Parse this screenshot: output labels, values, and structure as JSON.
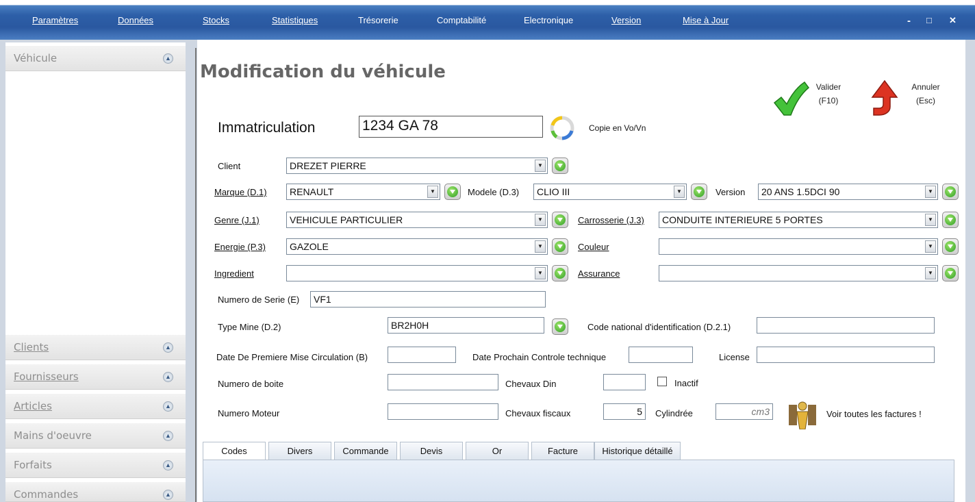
{
  "menu": {
    "items": [
      "Paramètres",
      "Données",
      "Stocks",
      "Statistiques",
      "Trésorerie",
      "Comptabilité",
      "Electronique",
      "Version",
      "Mise à Jour"
    ],
    "minimize": "-",
    "maximize": "□",
    "close": "✕"
  },
  "sidebar": {
    "top": "Véhicule",
    "items": [
      "Clients",
      "Fournisseurs",
      "Articles",
      "Mains d'oeuvre",
      "Forfaits",
      "Commandes"
    ]
  },
  "title": "Modification du véhicule",
  "actions": {
    "valider": "Valider",
    "valider_key": "(F10)",
    "annuler": "Annuler",
    "annuler_key": "(Esc)"
  },
  "immat": {
    "label": "Immatriculation",
    "value": "1234 GA 78",
    "copy_label": "Copie en Vo/Vn"
  },
  "fields": {
    "client_label": "Client",
    "client_value": "DREZET PIERRE",
    "marque_label": "Marque (D.1)",
    "marque_value": "RENAULT",
    "modele_label": "Modele (D.3)",
    "modele_value": "CLIO III",
    "version_label": "Version",
    "version_value": "20 ANS 1.5DCI 90",
    "genre_label": "Genre (J.1)",
    "genre_value": "VEHICULE PARTICULIER",
    "carrosserie_label": "Carrosserie (J.3)",
    "carrosserie_value": "CONDUITE INTERIEURE 5 PORTES",
    "energie_label": "Energie (P.3)",
    "energie_value": "GAZOLE",
    "couleur_label": "Couleur",
    "couleur_value": "",
    "ingredient_label": "Ingredient",
    "ingredient_value": "",
    "assurance_label": "Assurance",
    "assurance_value": "",
    "serie_label": "Numero de Serie (E)",
    "serie_value": "VF1",
    "typemine_label": "Type Mine (D.2)",
    "typemine_value": "BR2H0H",
    "codenat_label": "Code national d'identification (D.2.1)",
    "codenat_value": "",
    "date_mec_label": "Date De Premiere Mise Circulation (B)",
    "date_mec_value": "",
    "date_ct_label": "Date Prochain Controle technique",
    "date_ct_value": "",
    "license_label": "License",
    "license_value": "",
    "boite_label": "Numero de boite",
    "boite_value": "",
    "din_label": "Chevaux Din",
    "din_value": "",
    "inactif_label": "Inactif",
    "moteur_label": "Numero Moteur",
    "moteur_value": "",
    "fiscaux_label": "Chevaux fiscaux",
    "fiscaux_value": "5",
    "cylindree_label": "Cylindrée",
    "cylindree_placeholder": "cm3",
    "factures_label": "Voir toutes les factures !"
  },
  "tabs": [
    "Codes",
    "Divers",
    "Commande",
    "Devis",
    "Or",
    "Facture",
    "Historique détaillé"
  ],
  "colors": {
    "menubar": "#2d5fa8",
    "panel": "#d6e2f1",
    "accent_green": "#2f9e25",
    "accent_red": "#d9301e"
  }
}
